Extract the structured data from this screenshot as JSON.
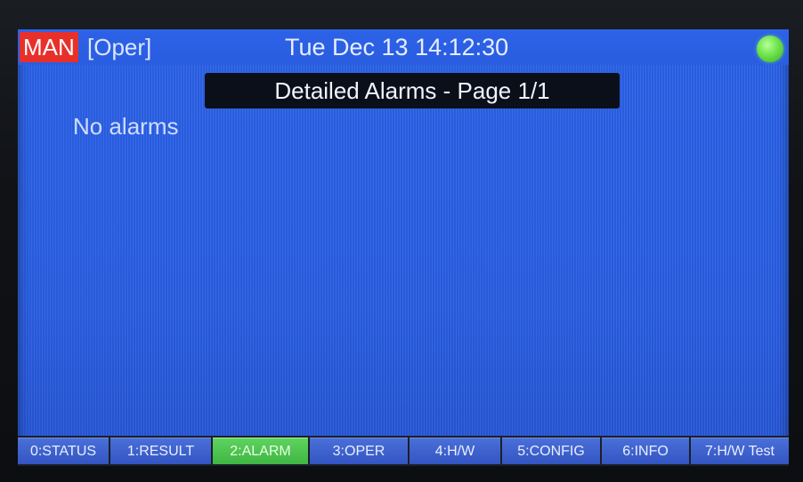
{
  "header": {
    "mode": "MAN",
    "submode": "[Oper]",
    "datetime": "Tue Dec 13 14:12:30",
    "status_led_color": "#6de34a",
    "mode_color": "#e8302b"
  },
  "main": {
    "title": "Detailed Alarms - Page 1/1",
    "empty_message": "No alarms"
  },
  "tabs": [
    {
      "label": "0:STATUS",
      "active": false
    },
    {
      "label": "1:RESULT",
      "active": false
    },
    {
      "label": "2:ALARM",
      "active": true
    },
    {
      "label": "3:OPER",
      "active": false
    },
    {
      "label": "4:H/W",
      "active": false
    },
    {
      "label": "5:CONFIG",
      "active": false
    },
    {
      "label": "6:INFO",
      "active": false
    },
    {
      "label": "7:H/W Test",
      "active": false
    }
  ],
  "colors": {
    "screen_background": "#2a5fe6",
    "active_tab": "#4fc44f",
    "title_bar": "#0b0f1a"
  }
}
